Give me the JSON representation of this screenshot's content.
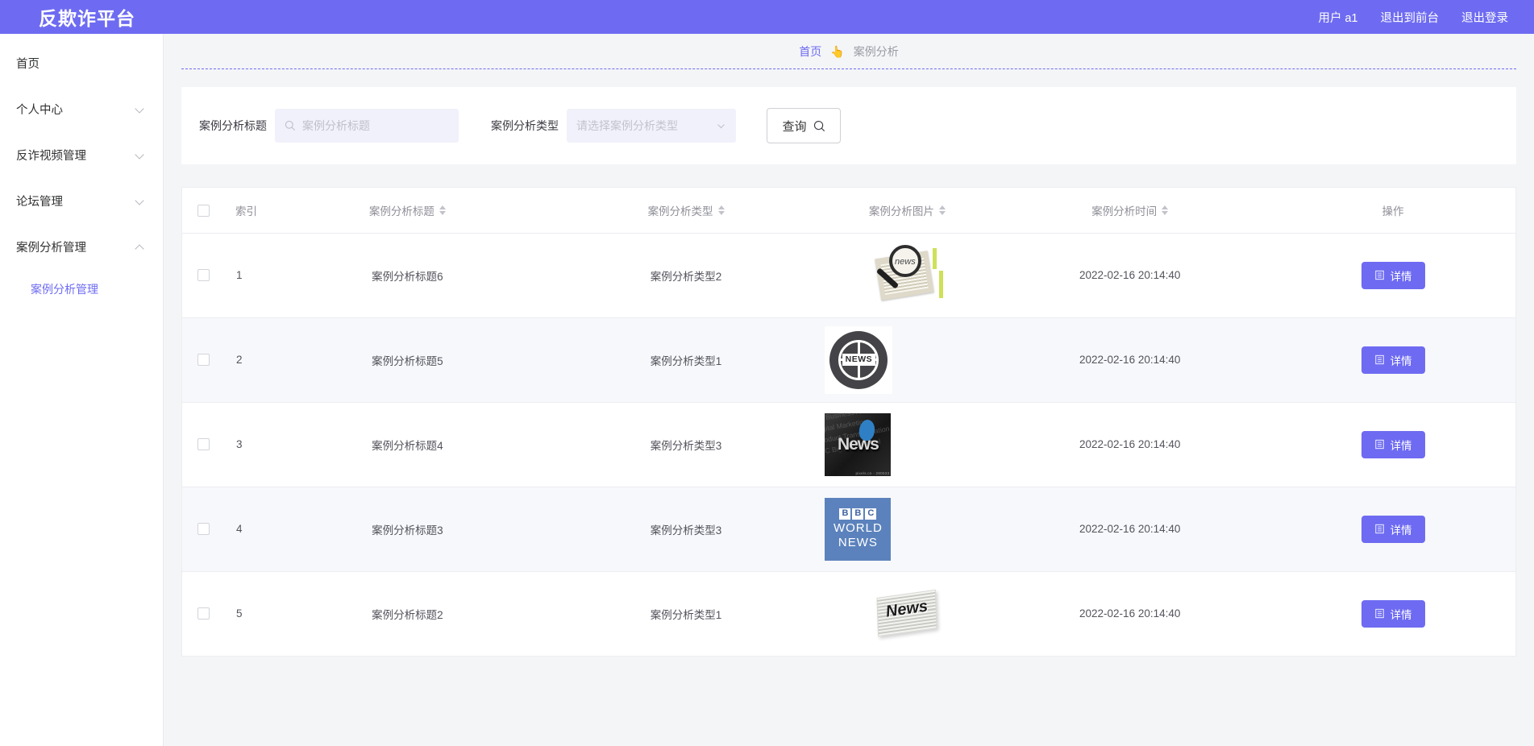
{
  "header": {
    "brand": "反欺诈平台",
    "user_label": "用户 a1",
    "logout_front_label": "退出到前台",
    "logout_label": "退出登录",
    "bg_color": "#6e6bf2"
  },
  "sidebar": {
    "items": [
      {
        "label": "首页",
        "has_children": false,
        "expanded": false
      },
      {
        "label": "个人中心",
        "has_children": true,
        "expanded": false
      },
      {
        "label": "反诈视频管理",
        "has_children": true,
        "expanded": false
      },
      {
        "label": "论坛管理",
        "has_children": true,
        "expanded": false
      },
      {
        "label": "案例分析管理",
        "has_children": true,
        "expanded": true
      }
    ],
    "submenu": [
      {
        "label": "案例分析管理",
        "active": true
      }
    ],
    "active_color": "#6e6bf2"
  },
  "breadcrumb": {
    "home": "首页",
    "separator": "👆",
    "current": "案例分析"
  },
  "filter": {
    "title_label": "案例分析标题",
    "title_placeholder": "案例分析标题",
    "title_value": "",
    "type_label": "案例分析类型",
    "type_placeholder": "请选择案例分析类型",
    "type_value": "",
    "query_button": "查询",
    "search_icon": "search-icon",
    "dropdown_icon": "chevron-down-icon"
  },
  "table": {
    "columns": [
      {
        "key": "checkbox",
        "label": "",
        "sortable": false
      },
      {
        "key": "index",
        "label": "索引",
        "sortable": false
      },
      {
        "key": "title",
        "label": "案例分析标题",
        "sortable": true
      },
      {
        "key": "type",
        "label": "案例分析类型",
        "sortable": true
      },
      {
        "key": "image",
        "label": "案例分析图片",
        "sortable": true
      },
      {
        "key": "time",
        "label": "案例分析时间",
        "sortable": true
      },
      {
        "key": "action",
        "label": "操作",
        "sortable": false
      }
    ],
    "rows": [
      {
        "index": "1",
        "title": "案例分析标题6",
        "type": "案例分析类型2",
        "image_name": "magnifier-newspaper-thumbnail",
        "image_text": "news",
        "time": "2022-02-16 20:14:40",
        "action": "详情"
      },
      {
        "index": "2",
        "title": "案例分析标题5",
        "type": "案例分析类型1",
        "image_name": "globe-news-badge-thumbnail",
        "image_text": "NEWS",
        "time": "2022-02-16 20:14:40",
        "action": "详情"
      },
      {
        "index": "3",
        "title": "案例分析标题4",
        "type": "案例分析类型3",
        "image_name": "dark-news-typography-thumbnail",
        "image_text": "News",
        "time": "2022-02-16 20:14:40",
        "action": "详情"
      },
      {
        "index": "4",
        "title": "案例分析标题3",
        "type": "案例分析类型3",
        "image_name": "bbc-world-news-thumbnail",
        "image_text": "BBC WORLD NEWS",
        "time": "2022-02-16 20:14:40",
        "action": "详情"
      },
      {
        "index": "5",
        "title": "案例分析标题2",
        "type": "案例分析类型1",
        "image_name": "folded-newspaper-thumbnail",
        "image_text": "News",
        "time": "2022-02-16 20:14:40",
        "action": "详情"
      }
    ],
    "detail_button_icon": "document-icon",
    "detail_button_color": "#6e6bf2"
  }
}
